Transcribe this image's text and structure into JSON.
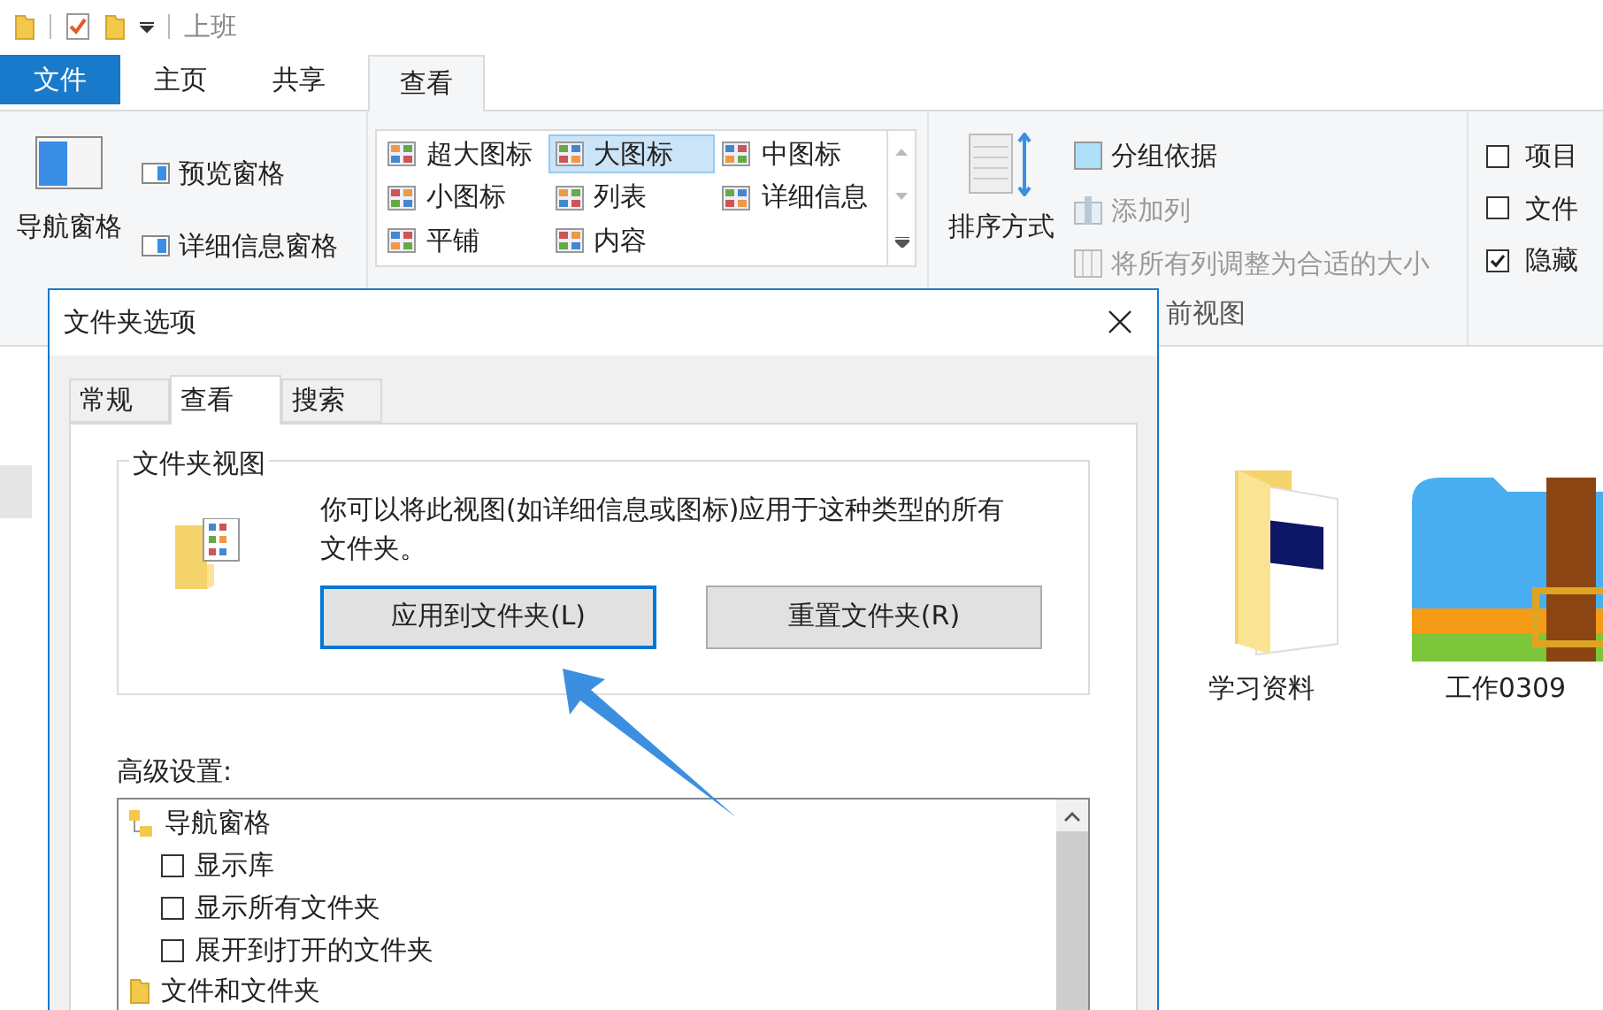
{
  "window": {
    "title": "上班"
  },
  "ribbon_tabs": [
    {
      "label": "文件",
      "kind": "file"
    },
    {
      "label": "主页",
      "kind": "tab",
      "selected": false
    },
    {
      "label": "共享",
      "kind": "tab",
      "selected": false
    },
    {
      "label": "查看",
      "kind": "tab",
      "selected": true
    }
  ],
  "panes": {
    "navigation": "导航窗格",
    "preview": "预览窗格",
    "details": "详细信息窗格"
  },
  "layouts": [
    {
      "label": "超大图标",
      "selected": false
    },
    {
      "label": "大图标",
      "selected": true
    },
    {
      "label": "中图标",
      "selected": false
    },
    {
      "label": "小图标",
      "selected": false
    },
    {
      "label": "列表",
      "selected": false
    },
    {
      "label": "详细信息",
      "selected": false
    },
    {
      "label": "平铺",
      "selected": false
    },
    {
      "label": "内容",
      "selected": false
    }
  ],
  "current_view": {
    "sort": "排序方式",
    "group_by": "分组依据",
    "add_column": "添加列",
    "size_columns": "将所有列调整为合适的大小",
    "group_label": "前视图"
  },
  "show_hide": [
    {
      "label": "项目",
      "checked": false
    },
    {
      "label": "文件",
      "checked": false
    },
    {
      "label": "隐藏",
      "checked": true
    }
  ],
  "files": [
    {
      "name": "学习资料",
      "kind": "folder"
    },
    {
      "name": "工作0309",
      "kind": "zip"
    }
  ],
  "dialog": {
    "title": "文件夹选项",
    "tabs": [
      {
        "label": "常规",
        "selected": false
      },
      {
        "label": "查看",
        "selected": true
      },
      {
        "label": "搜索",
        "selected": false
      }
    ],
    "folder_views": {
      "title": "文件夹视图",
      "description": "你可以将此视图(如详细信息或图标)应用于这种类型的所有文件夹。",
      "buttons": [
        {
          "label": "应用到文件夹(L)",
          "focused": true
        },
        {
          "label": "重置文件夹(R)",
          "focused": false
        }
      ]
    },
    "advanced_label": "高级设置:",
    "advanced": [
      {
        "label": "导航窗格",
        "kind": "group",
        "children": [
          {
            "label": "显示库",
            "kind": "checkbox",
            "checked": false
          },
          {
            "label": "显示所有文件夹",
            "kind": "checkbox",
            "checked": false
          },
          {
            "label": "展开到打开的文件夹",
            "kind": "checkbox",
            "checked": false
          }
        ]
      },
      {
        "label": "文件和文件夹",
        "kind": "folder"
      }
    ]
  }
}
